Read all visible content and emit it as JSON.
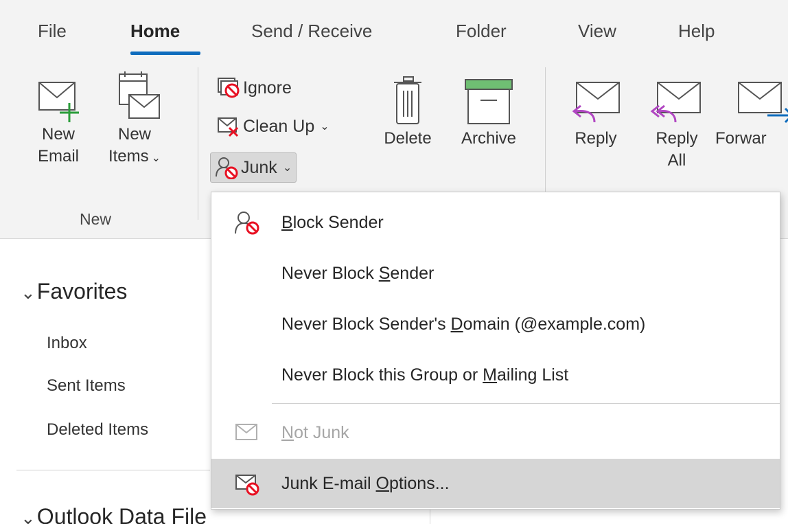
{
  "tabs": [
    {
      "label": "File"
    },
    {
      "label": "Home"
    },
    {
      "label": "Send / Receive"
    },
    {
      "label": "Folder"
    },
    {
      "label": "View"
    },
    {
      "label": "Help"
    }
  ],
  "ribbon": {
    "new_email": {
      "line1": "New",
      "line2": "Email"
    },
    "new_items": {
      "line1": "New",
      "line2": "Items"
    },
    "new_group_label": "New",
    "ignore": "Ignore",
    "clean_up": "Clean Up",
    "junk": "Junk",
    "delete": "Delete",
    "archive": "Archive",
    "reply": "Reply",
    "reply_all": {
      "line1": "Reply",
      "line2": "All"
    },
    "forward": "Forwar"
  },
  "nav": {
    "favorites": "Favorites",
    "items": [
      "Inbox",
      "Sent Items",
      "Deleted Items"
    ],
    "data_file": "Outlook Data File"
  },
  "junk_menu": {
    "block_sender": {
      "pre": "",
      "u": "B",
      "post": "lock Sender"
    },
    "never_block_sender": {
      "pre": "Never Block ",
      "u": "S",
      "post": "ender"
    },
    "never_block_domain": {
      "pre": "Never Block Sender's ",
      "u": "D",
      "post": "omain (@example.com)"
    },
    "never_block_group": {
      "pre": "Never Block this Group or ",
      "u": "M",
      "post": "ailing List"
    },
    "not_junk": {
      "pre": "",
      "u": "N",
      "post": "ot Junk"
    },
    "junk_options": {
      "pre": "Junk E-mail ",
      "u": "O",
      "post": "ptions..."
    }
  },
  "colors": {
    "accent": "#0f6cbd",
    "block_red": "#e81123",
    "plus_green": "#2a9d3a",
    "reply_purple": "#b146c2",
    "forward_blue": "#0f6cbd",
    "archive_green": "#6fbf73"
  }
}
